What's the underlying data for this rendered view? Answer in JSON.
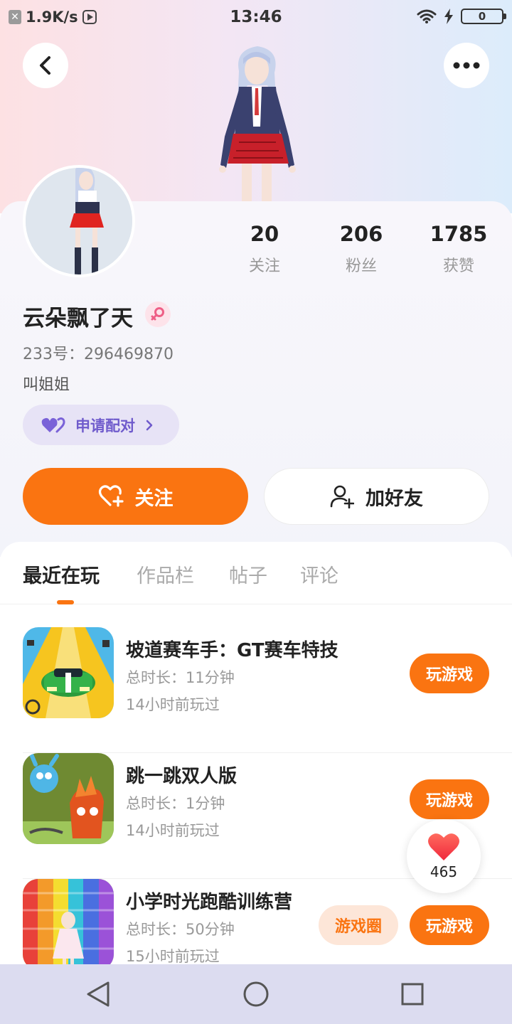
{
  "status_bar": {
    "speed": "1.9K/s",
    "time": "13:46",
    "battery": "0"
  },
  "profile": {
    "username": "云朵飘了天",
    "uid": "233号：296469870",
    "bio": "叫姐姐",
    "pair_label": "申请配对",
    "stats": [
      {
        "value": "20",
        "label": "关注"
      },
      {
        "value": "206",
        "label": "粉丝"
      },
      {
        "value": "1785",
        "label": "获赞"
      }
    ],
    "follow_label": "关注",
    "add_friend_label": "加好友"
  },
  "tabs": [
    {
      "label": "最近在玩",
      "active": true
    },
    {
      "label": "作品栏",
      "active": false
    },
    {
      "label": "帖子",
      "active": false
    },
    {
      "label": "评论",
      "active": false
    }
  ],
  "games": [
    {
      "title": "坡道赛车手：GT赛车特技",
      "duration": "总时长：11分钟",
      "last_played": "14小时前玩过",
      "play_label": "玩游戏"
    },
    {
      "title": "跳一跳双人版",
      "duration": "总时长：1分钟",
      "last_played": "14小时前玩过",
      "play_label": "玩游戏"
    },
    {
      "title": "小学时光跑酷训练营",
      "duration": "总时长：50分钟",
      "last_played": "15小时前玩过",
      "play_label": "玩游戏",
      "circle_label": "游戏圈"
    }
  ],
  "like_float": {
    "count": "465"
  },
  "colors": {
    "accent": "#fa7411",
    "pair_text": "#6f5bcc",
    "pair_bg": "#e7e3f6",
    "nav_bg": "#dcdcf0"
  },
  "icons": [
    "back-icon",
    "more-icon",
    "heart-pair-icon",
    "chevron-right-icon",
    "follow-heart-icon",
    "add-friend-icon",
    "female-icon",
    "heart-icon",
    "nav-back-icon",
    "nav-home-icon",
    "nav-recent-icon",
    "wifi-icon",
    "charging-icon"
  ]
}
